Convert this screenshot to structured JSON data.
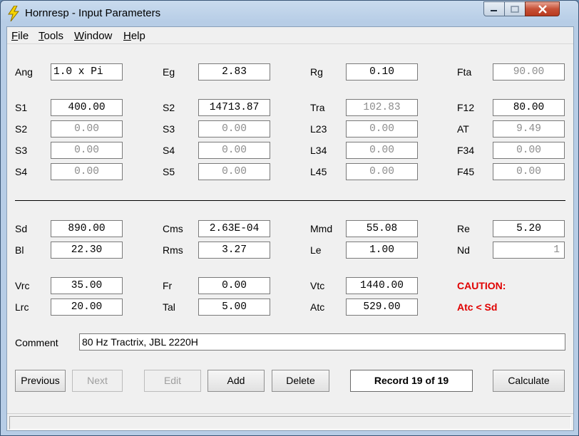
{
  "window": {
    "title": "Hornresp - Input Parameters"
  },
  "menu": [
    "File",
    "Tools",
    "Window",
    "Help"
  ],
  "params": {
    "Ang": "1.0 x Pi",
    "Eg": "2.83",
    "Rg": "0.10",
    "Fta": "90.00",
    "S1": "400.00",
    "S2a": "14713.87",
    "Tra": "102.83",
    "F12": "80.00",
    "S2b": "0.00",
    "S3a": "0.00",
    "L23": "0.00",
    "AT": "9.49",
    "S3b": "0.00",
    "S4a": "0.00",
    "L34": "0.00",
    "F34": "0.00",
    "S4b": "0.00",
    "S5": "0.00",
    "L45": "0.00",
    "F45": "0.00",
    "Sd": "890.00",
    "Cms": "2.63E-04",
    "Mmd": "55.08",
    "Re": "5.20",
    "Bl": "22.30",
    "Rms": "3.27",
    "Le": "1.00",
    "Nd": "1",
    "Vrc": "35.00",
    "Fr": "0.00",
    "Vtc": "1440.00",
    "Lrc": "20.00",
    "Tal": "5.00",
    "Atc": "529.00"
  },
  "labels": {
    "Ang": "Ang",
    "Eg": "Eg",
    "Rg": "Rg",
    "Fta": "Fta",
    "S1": "S1",
    "S2a": "S2",
    "Tra": "Tra",
    "F12": "F12",
    "S2b": "S2",
    "S3a": "S3",
    "L23": "L23",
    "AT": "AT",
    "S3b": "S3",
    "S4a": "S4",
    "L34": "L34",
    "F34": "F34",
    "S4b": "S4",
    "S5": "S5",
    "L45": "L45",
    "F45": "F45",
    "Sd": "Sd",
    "Cms": "Cms",
    "Mmd": "Mmd",
    "Re": "Re",
    "Bl": "Bl",
    "Rms": "Rms",
    "Le": "Le",
    "Nd": "Nd",
    "Vrc": "Vrc",
    "Fr": "Fr",
    "Vtc": "Vtc",
    "Lrc": "Lrc",
    "Tal": "Tal",
    "Atc": "Atc",
    "comment": "Comment"
  },
  "caution": {
    "title": "CAUTION:",
    "message": "Atc < Sd"
  },
  "comment": "80 Hz Tractrix, JBL 2220H",
  "buttons": {
    "previous": "Previous",
    "next": "Next",
    "edit": "Edit",
    "add": "Add",
    "delete": "Delete",
    "calculate": "Calculate"
  },
  "record": "Record 19 of 19",
  "colors": {
    "warning": "#e00000",
    "disabled_text": "#8c8c8c"
  }
}
